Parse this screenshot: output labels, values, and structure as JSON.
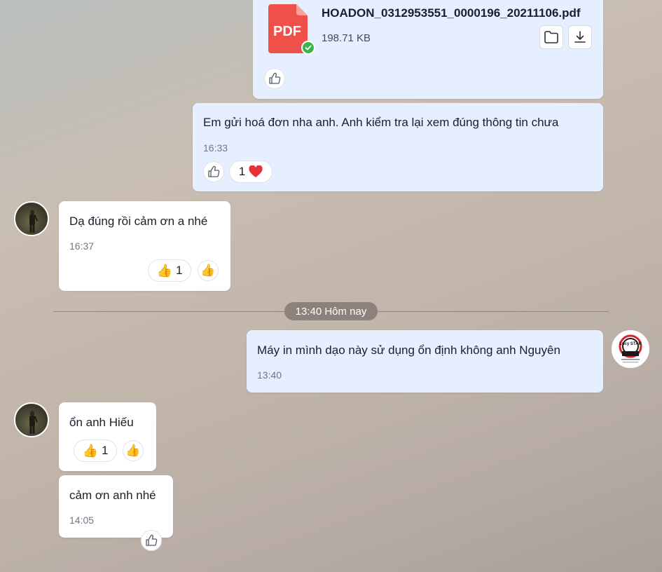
{
  "file_message": {
    "file_name": "HOADON_0312953551_0000196_20211106.pdf",
    "file_size": "198.71 KB",
    "file_type_label": "PDF",
    "icons": [
      "pdf-file-icon",
      "check-badge-icon",
      "folder-icon",
      "download-icon",
      "like-icon"
    ]
  },
  "messages": [
    {
      "sender": "me",
      "text": "Em gửi hoá đơn nha anh. Anh kiểm tra lại xem đúng thông tin chưa",
      "time": "16:33",
      "reaction_count": "1",
      "reaction": "heart"
    },
    {
      "sender": "them",
      "text": "Dạ đúng rồi cảm ơn a nhé",
      "time": "16:37",
      "reaction_count": "1",
      "reaction": "thumbs-up"
    },
    {
      "sender": "me",
      "text": "Máy in mình dạo này sử dụng ổn định không anh Nguyên",
      "time": "13:40"
    },
    {
      "sender": "them",
      "text": "ổn anh Hiếu",
      "reaction_count": "1",
      "reaction": "thumbs-up"
    },
    {
      "sender": "them",
      "text": "cảm ơn anh nhé",
      "time": "14:05"
    }
  ],
  "date_divider": "13:40 Hôm nay",
  "my_avatar": {
    "logo_text": "Lucy STAR"
  },
  "colors": {
    "my_bubble": "#e5efff",
    "their_bubble": "#ffffff",
    "pdf_red": "#f0504a",
    "heart": "#e8313b",
    "check_green": "#3ab54a"
  }
}
